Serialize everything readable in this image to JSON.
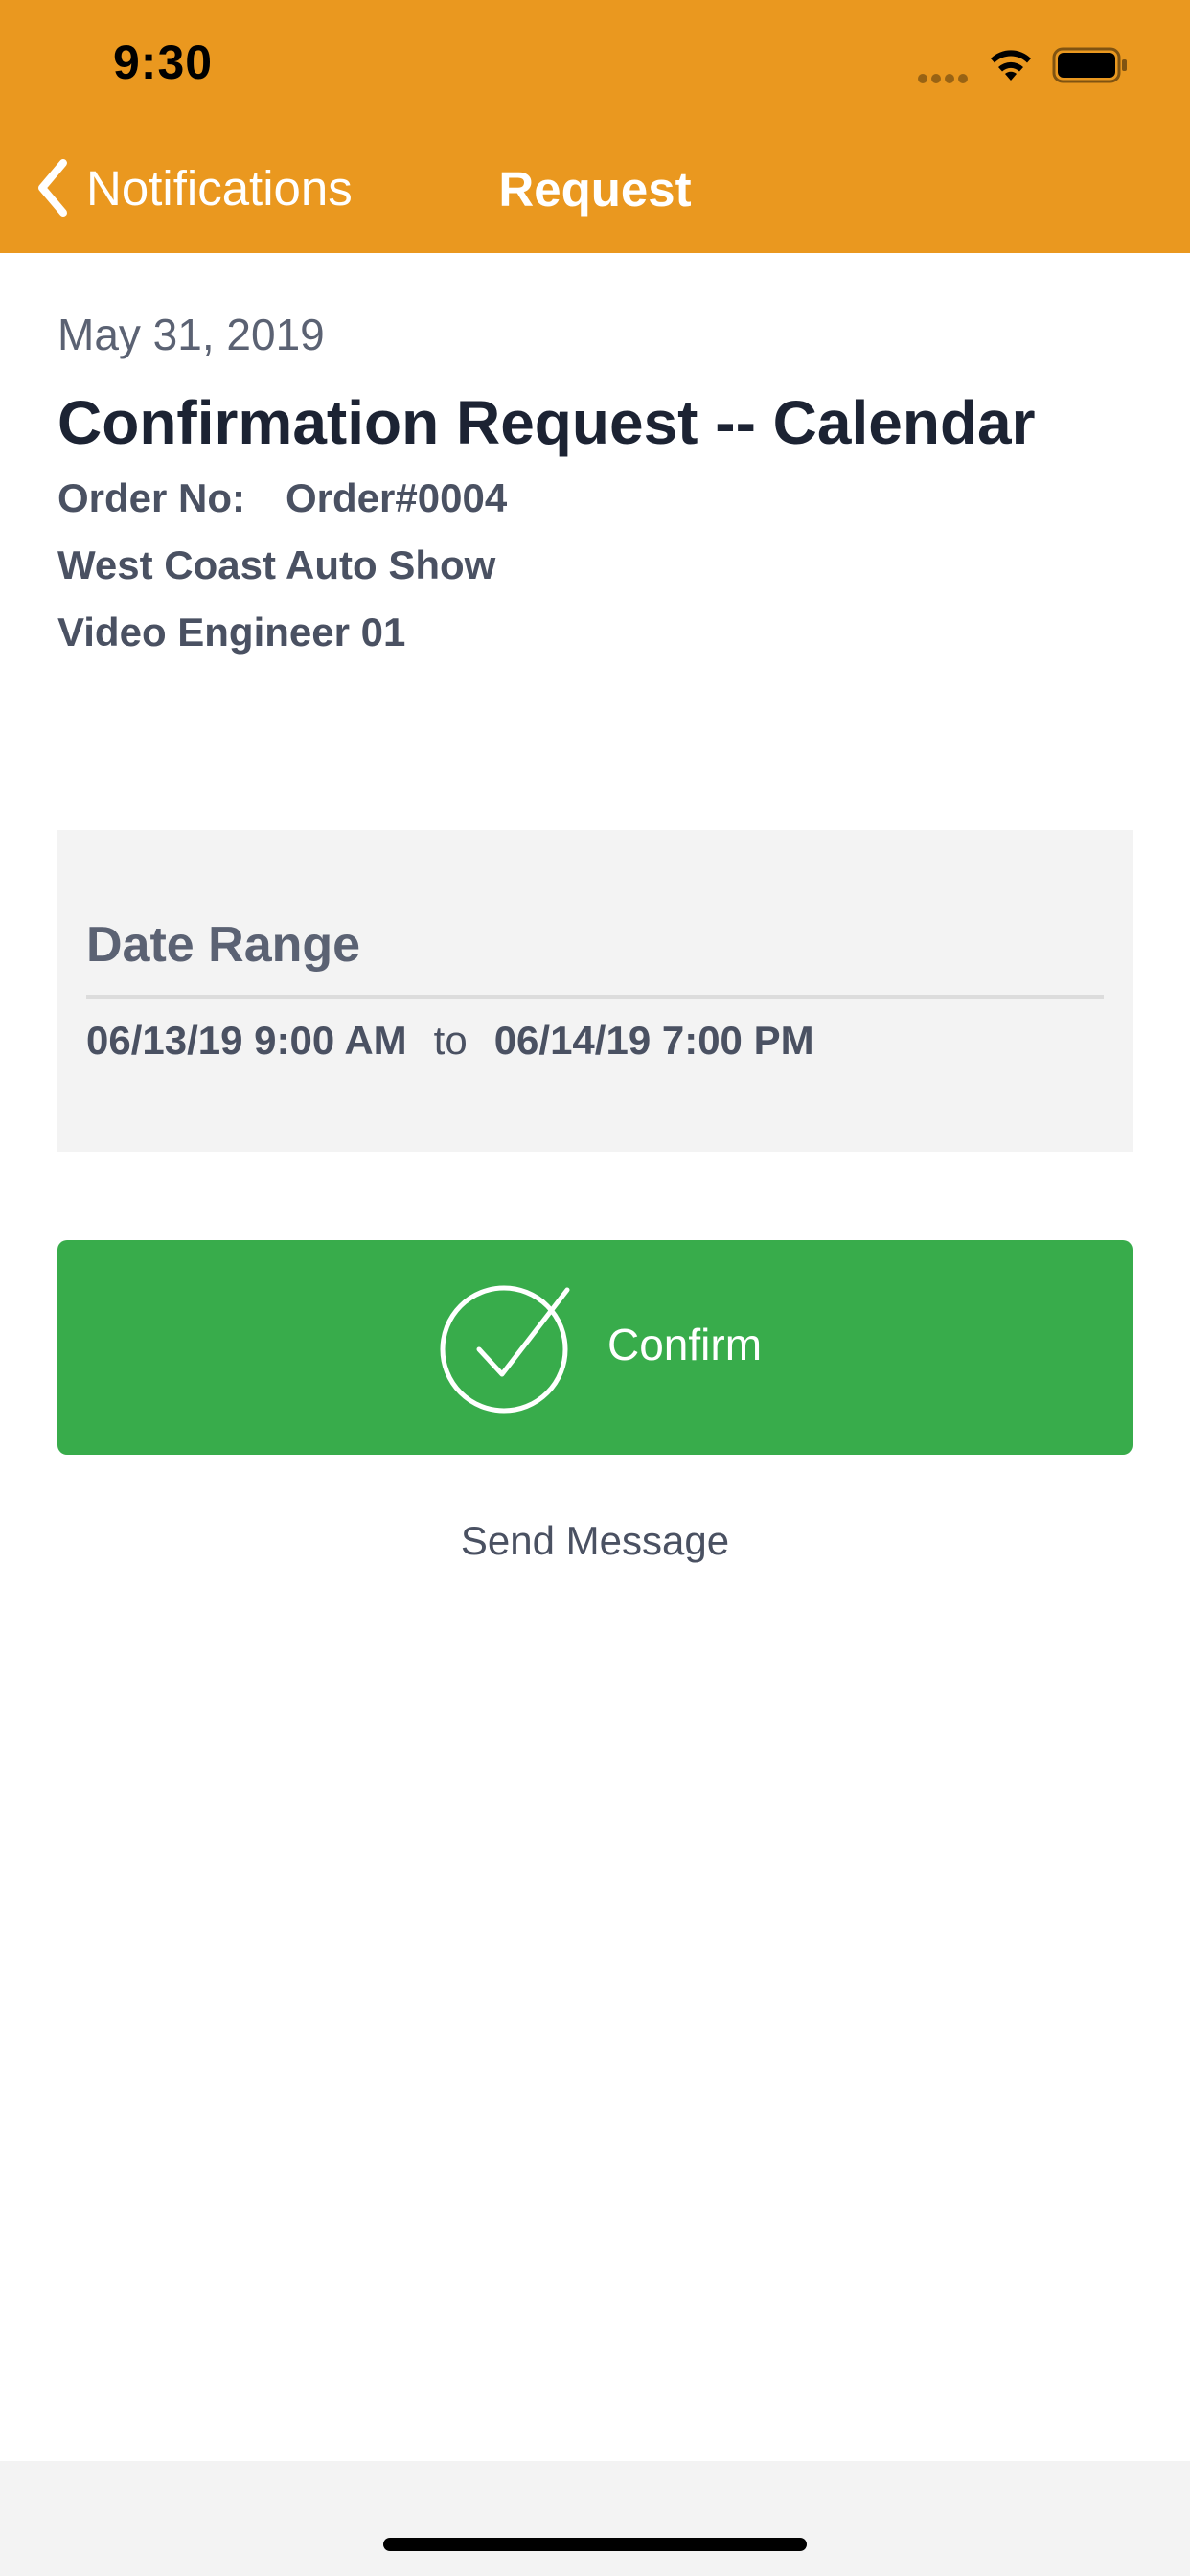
{
  "status_bar": {
    "time": "9:30",
    "icons": [
      "signal-icon",
      "wifi-icon",
      "battery-icon"
    ]
  },
  "nav": {
    "back_label": "Notifications",
    "back_icon": "chevron-left-icon",
    "title": "Request"
  },
  "request": {
    "date": "May 31, 2019",
    "title": "Confirmation Request -- Calendar",
    "order_label": "Order No:",
    "order_value": "Order#0004",
    "event": "West Coast Auto Show",
    "role": "Video Engineer 01"
  },
  "date_range": {
    "label": "Date Range",
    "start": "06/13/19 9:00 AM",
    "separator": "to",
    "end": "06/14/19 7:00 PM"
  },
  "actions": {
    "confirm_label": "Confirm",
    "confirm_icon": "check-circle-icon",
    "send_message_label": "Send Message"
  },
  "colors": {
    "header": "#EA981F",
    "confirm": "#38AC4B",
    "card": "#F3F3F3",
    "title_text": "#1C2333",
    "body_text": "#4A5162"
  }
}
